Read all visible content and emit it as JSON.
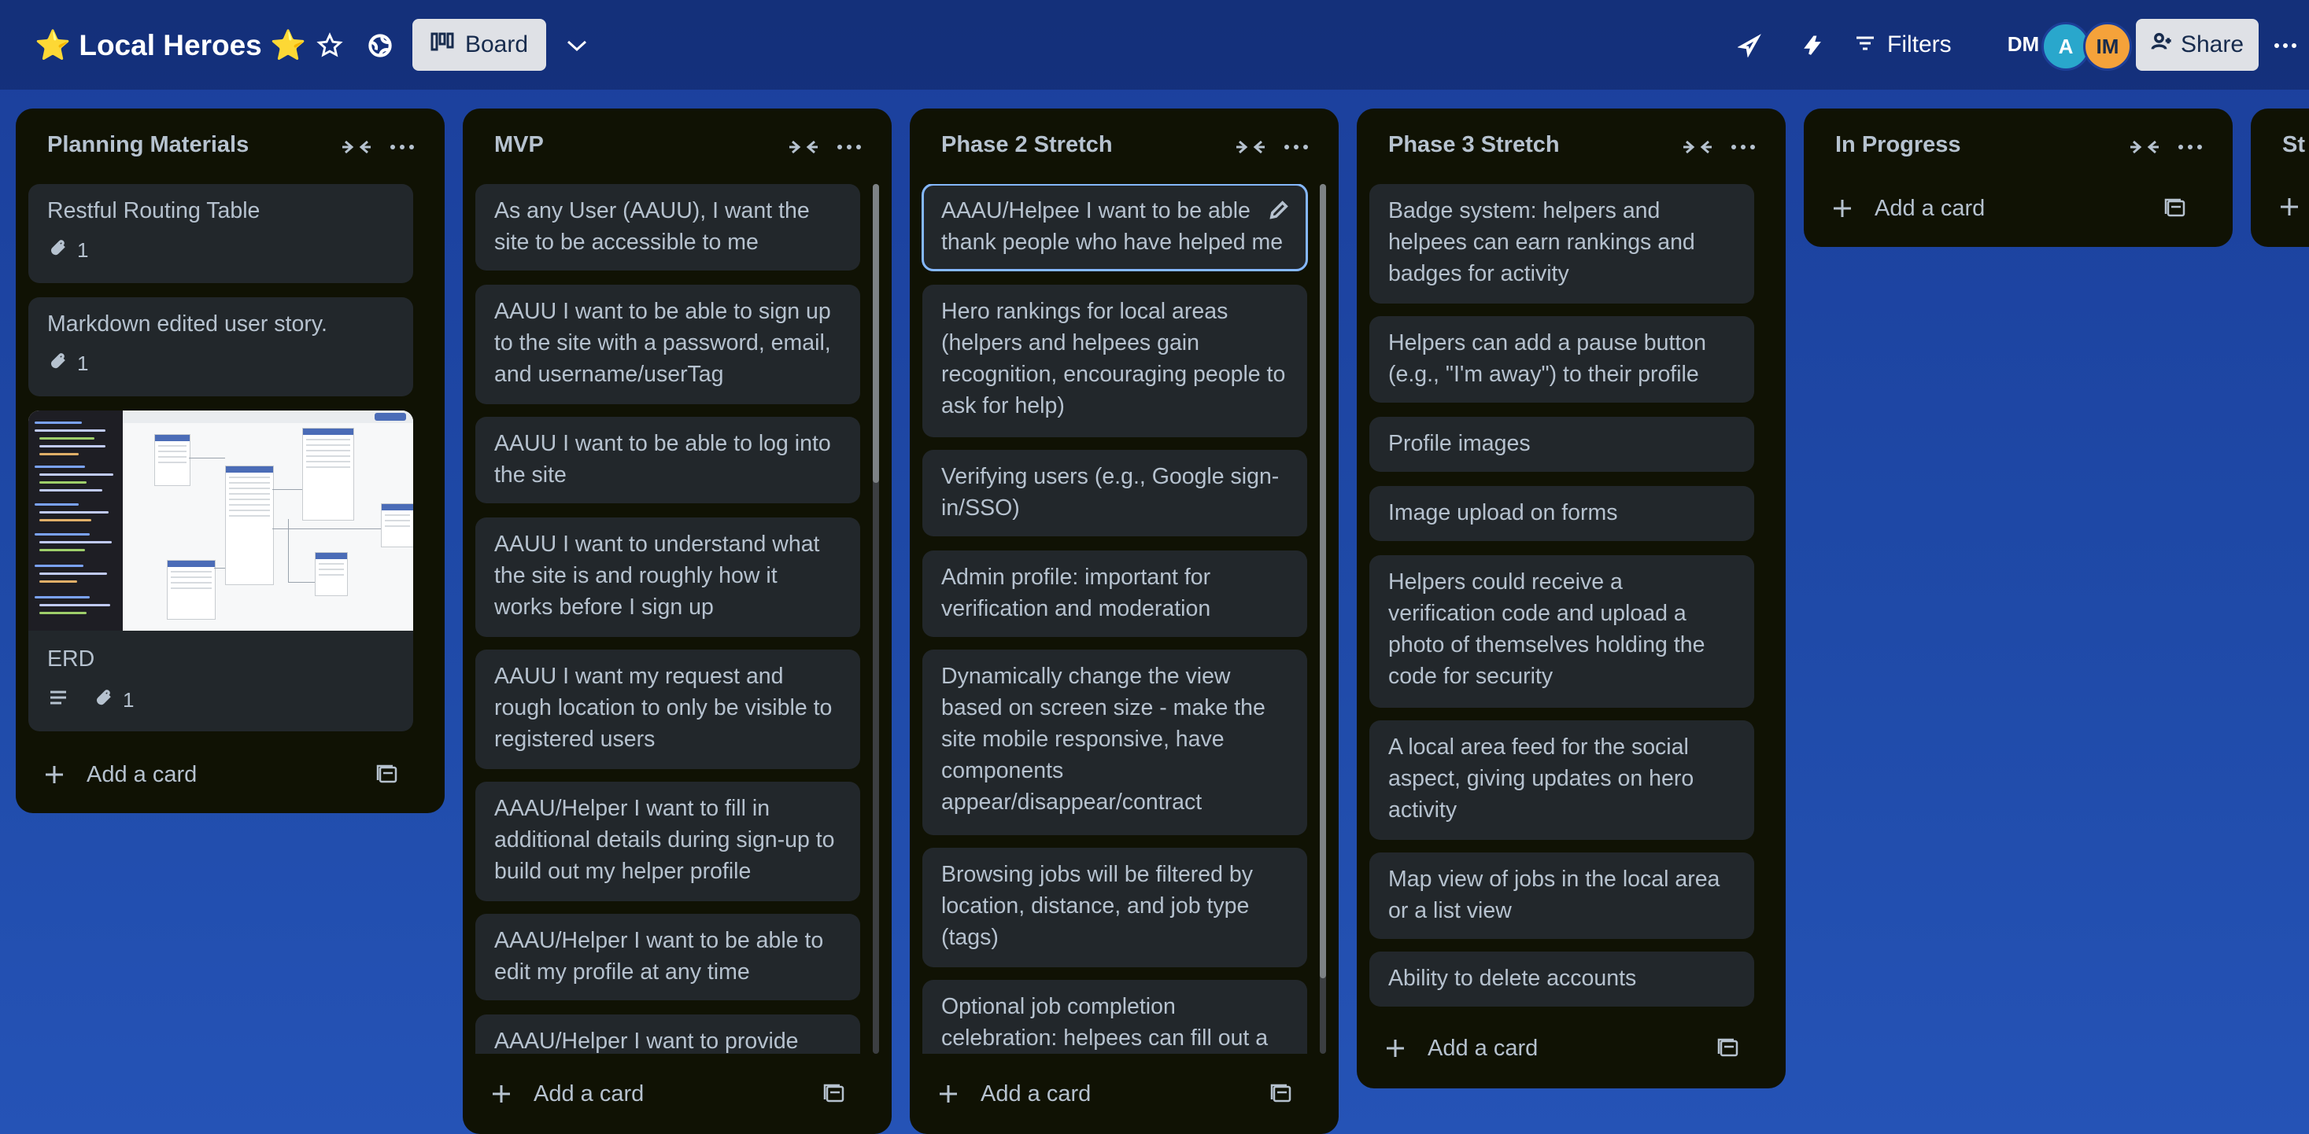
{
  "board": {
    "title": "⭐️ Local Heroes ⭐️",
    "view_label": "Board",
    "filters_label": "Filters",
    "share_label": "Share",
    "members": [
      "DM",
      "A",
      "IM"
    ],
    "icons": [
      "star-icon",
      "globe-icon",
      "board-view-icon",
      "chevron-down-icon",
      "rocket-icon",
      "lightning-icon",
      "filter-icon",
      "add-person-icon",
      "more-icon"
    ]
  },
  "lists": [
    {
      "title": "Planning Materials",
      "cards": [
        {
          "text": "Restful Routing Table",
          "attachments": "1"
        },
        {
          "text": "Markdown edited user story.",
          "attachments": "1"
        },
        {
          "text": "ERD",
          "attachments": "1",
          "has_description": true,
          "has_cover": true
        }
      ],
      "add_label": "Add a card"
    },
    {
      "title": "MVP",
      "cards": [
        {
          "text": "As any User (AAUU), I want the site to be accessible to me"
        },
        {
          "text": "AAUU I want to be able to sign up to the site with a password, email, and username/userTag"
        },
        {
          "text": "AAUU I want to be able to log into the site"
        },
        {
          "text": "AAUU I want to understand what the site is and roughly how it works before I sign up"
        },
        {
          "text": "AAUU I want my request and rough location to only be visible to registered users"
        },
        {
          "text": "AAAU/Helper I want to fill in additional details during sign-up to build out my helper profile"
        },
        {
          "text": "AAAU/Helper I want to be able to edit my profile at any time"
        },
        {
          "text": "AAAU/Helper I want to provide"
        }
      ],
      "add_label": "Add a card"
    },
    {
      "title": "Phase 2 Stretch",
      "cards": [
        {
          "text": "AAAU/Helpee I want to be able thank people who have helped me"
        },
        {
          "text": "Hero rankings for local areas (helpers and helpees gain recognition, encouraging people to ask for help)"
        },
        {
          "text": "Verifying users (e.g., Google sign-in/SSO)"
        },
        {
          "text": "Admin profile: important for verification and moderation"
        },
        {
          "text": "Dynamically change the view based on screen size - make the site mobile responsive, have components appear/disappear/contract"
        },
        {
          "text": "Browsing jobs will be filtered by location, distance, and job type (tags)"
        },
        {
          "text": "Optional job completion celebration: helpees can fill out a"
        }
      ],
      "add_label": "Add a card"
    },
    {
      "title": "Phase 3 Stretch",
      "cards": [
        {
          "text": "Badge system: helpers and helpees can earn rankings and badges for activity"
        },
        {
          "text": "Helpers can add a pause button (e.g., \"I'm away\") to their profile"
        },
        {
          "text": "Profile images"
        },
        {
          "text": "Image upload on forms"
        },
        {
          "text": "Helpers could receive a verification code and upload a photo of themselves holding the code for security"
        },
        {
          "text": "A local area feed for the social aspect, giving updates on hero activity"
        },
        {
          "text": "Map view of jobs in the local area or a list view"
        },
        {
          "text": "Ability to delete accounts"
        }
      ],
      "add_label": "Add a card"
    },
    {
      "title": "In Progress",
      "cards": [],
      "add_label": "Add a card"
    },
    {
      "title": "St",
      "cards": [],
      "add_label": ""
    }
  ]
}
